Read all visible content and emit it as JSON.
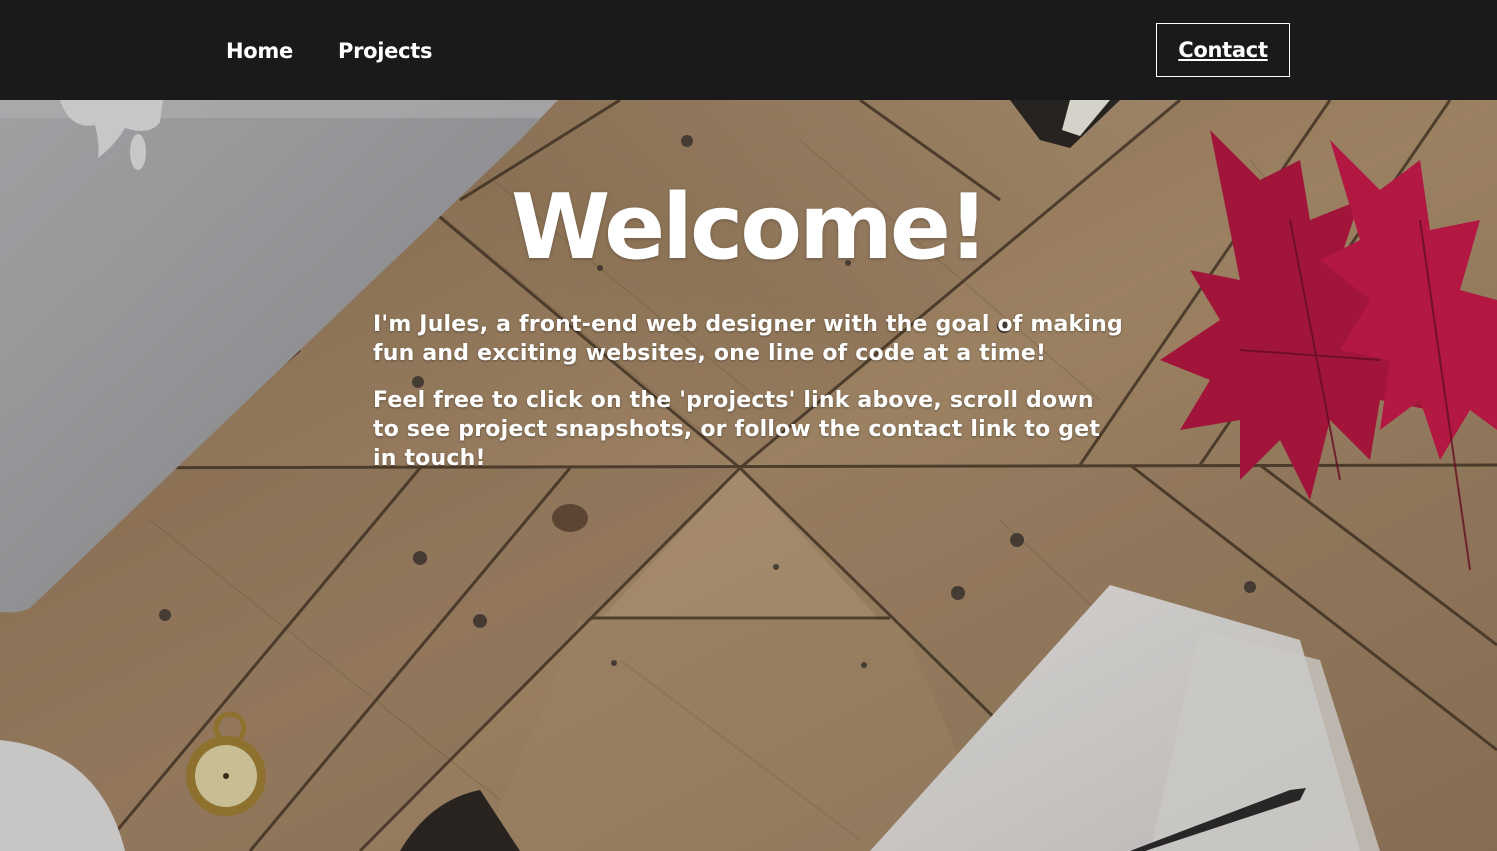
{
  "nav": {
    "home_label": "Home",
    "projects_label": "Projects",
    "contact_label": "Contact"
  },
  "hero": {
    "title": "Welcome!",
    "intro": "I'm Jules, a front-end web designer with the goal of making fun and exciting websites, one line of code at a time!",
    "cta_text": "Feel free to click on the 'projects' link above, scroll down to see project snapshots, or follow the contact link to get in touch!"
  },
  "colors": {
    "navbar_bg": "#1b1a1a",
    "text": "#ffffff",
    "wood": "#9c8262"
  }
}
